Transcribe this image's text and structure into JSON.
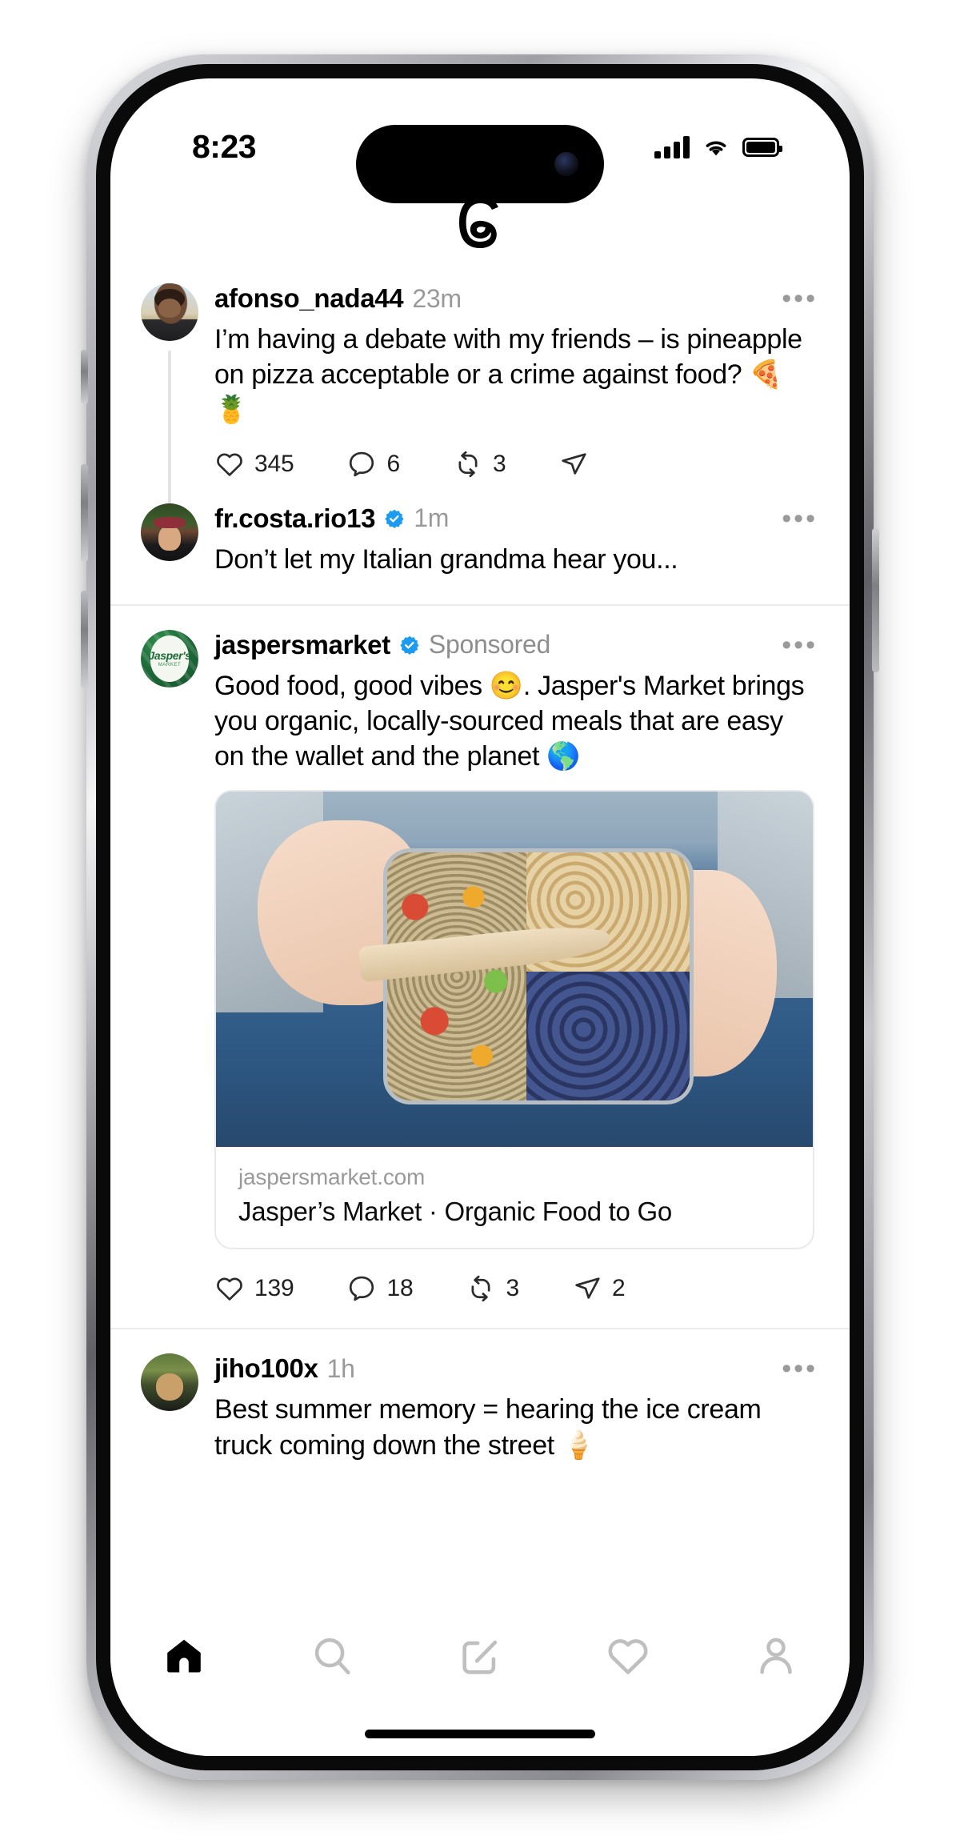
{
  "status_bar": {
    "time": "8:23",
    "signal_icon": "cellular-signal-icon",
    "wifi_icon": "wifi-icon",
    "battery_icon": "battery-full-icon"
  },
  "app": {
    "name": "Threads",
    "logo_icon": "threads-logo-icon"
  },
  "feed": {
    "posts": [
      {
        "id": "post-afonso",
        "username": "afonso_nada44",
        "verified": false,
        "timestamp": "23m",
        "avatar_name": "avatar-afonso",
        "text": "I’m having a debate with my friends – is pineapple on pizza acceptable or a crime against food? 🍕🍍",
        "more_icon": "more-options-icon",
        "actions": {
          "like": {
            "icon": "heart-icon",
            "count": "345"
          },
          "reply": {
            "icon": "comment-icon",
            "count": "6"
          },
          "repost": {
            "icon": "repost-icon",
            "count": "3"
          },
          "share": {
            "icon": "share-icon",
            "count": ""
          }
        }
      },
      {
        "id": "post-frcosta",
        "username": "fr.costa.rio13",
        "verified": true,
        "timestamp": "1m",
        "avatar_name": "avatar-frcosta",
        "text": "Don’t let my Italian grandma hear you...",
        "more_icon": "more-options-icon"
      },
      {
        "id": "post-jaspersmarket-ad",
        "username": "jaspersmarket",
        "verified": true,
        "timestamp": "Sponsored",
        "avatar_name": "avatar-jaspersmarket",
        "brand_logo": {
          "name": "Jasper's",
          "sub": "MARKET"
        },
        "text": "Good food, good vibes 😊. Jasper's Market brings you organic, locally-sourced meals that are easy on the wallet and the planet 🌎",
        "more_icon": "more-options-icon",
        "media": {
          "image_name": "bento-lunchbox-photo",
          "alt": "Hands holding a metal bento box with nuts, blueberries and quinoa salad"
        },
        "link_card": {
          "domain": "jaspersmarket.com",
          "title": "Jasper’s Market · Organic Food to Go"
        },
        "actions": {
          "like": {
            "icon": "heart-icon",
            "count": "139"
          },
          "reply": {
            "icon": "comment-icon",
            "count": "18"
          },
          "repost": {
            "icon": "repost-icon",
            "count": "3"
          },
          "share": {
            "icon": "share-icon",
            "count": "2"
          }
        }
      },
      {
        "id": "post-jiho",
        "username": "jiho100x",
        "verified": false,
        "timestamp": "1h",
        "avatar_name": "avatar-jiho",
        "text": "Best summer memory = hearing the ice cream truck coming down the street 🍦",
        "more_icon": "more-options-icon"
      }
    ]
  },
  "tab_bar": {
    "items": [
      {
        "name": "tab-home",
        "icon": "home-icon",
        "active": true
      },
      {
        "name": "tab-search",
        "icon": "search-icon",
        "active": false
      },
      {
        "name": "tab-compose",
        "icon": "compose-icon",
        "active": false
      },
      {
        "name": "tab-activity",
        "icon": "heart-icon",
        "active": false
      },
      {
        "name": "tab-profile",
        "icon": "profile-icon",
        "active": false
      }
    ]
  },
  "colors": {
    "verified_blue": "#1d9bf0",
    "brand_green": "#1f6b39",
    "muted_text": "#999999",
    "divider": "#ededee",
    "active_tab": "#000000",
    "inactive_tab": "#bfbfbf"
  }
}
